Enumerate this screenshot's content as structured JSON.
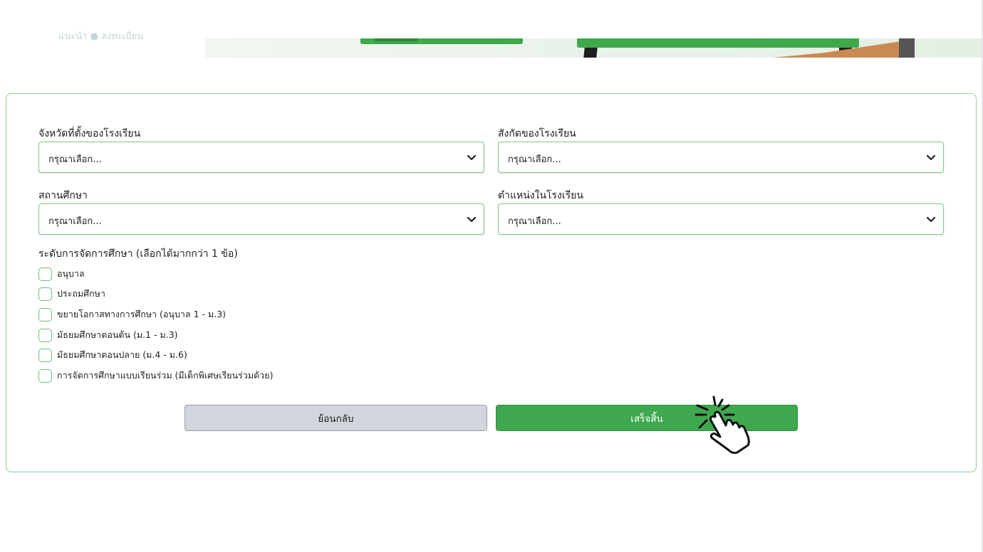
{
  "banner": {
    "left_text": "แนะนำ ● ลงทะเบียน"
  },
  "form": {
    "province": {
      "label": "จังหวัดที่ตั้งของโรงเรียน",
      "value": "กรุณาเลือก..."
    },
    "affiliation": {
      "label": "สังกัดของโรงเรียน",
      "value": "กรุณาเลือก..."
    },
    "school": {
      "label": "สถานศึกษา",
      "value": "กรุณาเลือก..."
    },
    "position": {
      "label": "ตำแหน่งในโรงเรียน",
      "value": "กรุณาเลือก..."
    },
    "levels": {
      "title": "ระดับการจัดการศึกษา (เลือกได้มากกว่า 1 ข้อ)",
      "options": [
        {
          "label": "อนุบาล",
          "checked": false
        },
        {
          "label": "ประถมศึกษา",
          "checked": false
        },
        {
          "label": "ขยายโอกาสทางการศึกษา (อนุบาล 1 - ม.3)",
          "checked": false
        },
        {
          "label": "มัธยมศึกษาตอนต้น (ม.1 - ม.3)",
          "checked": false
        },
        {
          "label": "มัธยมศึกษาตอนปลาย (ม.4 - ม.6)",
          "checked": false
        },
        {
          "label": "การจัดการศึกษาแบบเรียนร่วม (มีเด็กพิเศษเรียนร่วมด้วย)",
          "checked": false
        }
      ]
    },
    "buttons": {
      "back_label": "ย้อนกลับ",
      "finish_label": "เสร็จสิ้น"
    }
  },
  "colors": {
    "accent": "#3fa84e",
    "border": "#7cc98a",
    "back_button": "#d2d5dc"
  },
  "icons": {
    "select_arrow": "chevron-down-icon",
    "pointer": "hand-click-icon"
  }
}
